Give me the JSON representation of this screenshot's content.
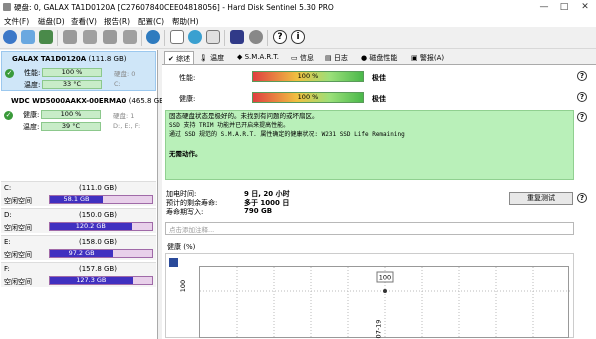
{
  "window": {
    "title": "硬盘: 0, GALAX TA1D0120A [C27607840CEE04818056]  -  Hard Disk Sentinel 5.30 PRO",
    "minimize": "—",
    "maximize": "□",
    "close": "✕"
  },
  "menu": [
    "文件(F)",
    "磁盘(D)",
    "查看(V)",
    "报告(R)",
    "配置(C)",
    "帮助(H)"
  ],
  "toolbar_icons": [
    "refresh-icon",
    "disk-info-icon",
    "image-icon",
    "drive-test-1-icon",
    "drive-test-2-icon",
    "drive-test-3-icon",
    "drive-test-4-icon",
    "globe-icon",
    "document-icon",
    "recycle-icon",
    "export-icon",
    "report-icon",
    "settings-icon",
    "help-icon",
    "info-icon"
  ],
  "disks": [
    {
      "name": "GALAX TA1D0120A",
      "size": "(111.8 GB)",
      "perf_label": "性能:",
      "perf": "100 %",
      "perf_sub": "硬盘: 0",
      "temp_label": "温度:",
      "temp": "33 °C",
      "temp_sub": "C:"
    },
    {
      "name": "WDC WD5000AAKX-00ERMA0",
      "size": "(465.8 GB)",
      "perf_label": "健康:",
      "perf": "100 %",
      "perf_sub": "硬盘: 1",
      "temp_label": "温度:",
      "temp": "39 °C",
      "temp_sub": "D:, E:, F:"
    }
  ],
  "partitions": [
    {
      "letter": "C:",
      "size": "(111.0 GB)",
      "free_label": "空闲空间",
      "free": "58.1 GB",
      "free_fraction": 0.52
    },
    {
      "letter": "D:",
      "size": "(150.0 GB)",
      "free_label": "空闲空间",
      "free": "120.2 GB",
      "free_fraction": 0.8
    },
    {
      "letter": "E:",
      "size": "(158.0 GB)",
      "free_label": "空闲空间",
      "free": "97.2 GB",
      "free_fraction": 0.62
    },
    {
      "letter": "F:",
      "size": "(157.8 GB)",
      "free_label": "空闲空间",
      "free": "127.3 GB",
      "free_fraction": 0.81
    }
  ],
  "tabs": [
    "综述",
    "温度",
    "S.M.A.R.T.",
    "信息",
    "日志",
    "磁盘性能",
    "警报(A)"
  ],
  "overview": {
    "perf_label": "性能:",
    "perf_value": "100 %",
    "perf_status": "极佳",
    "health_label": "健康:",
    "health_value": "100 %",
    "health_status": "极佳",
    "message_line1": "固态硬盘状态是极好的。未找到有问题的或坏扇区。",
    "message_line2": "SSD 支持 TRIM 功能并已开启来提高性能。",
    "message_line3": "通过 SSD 规范的 S.M.A.R.T. 属性确定的健康状况:    W231 SSD Life Remaining",
    "message_action": "无需动作。",
    "power_on_label": "加电时间:",
    "power_on_value": "9 日, 20 小时",
    "remaining_label": "预计的剩余寿命:",
    "remaining_value": "多于 1000 日",
    "lifetime_label": "寿命期写入:",
    "lifetime_value": "790 GB",
    "retest_button": "重复测试",
    "comment_placeholder": "点击添加注释...",
    "chart_tab": "健康 (%)"
  },
  "chart_data": {
    "type": "line",
    "x": [
      "07-19"
    ],
    "y_axis_label": "100",
    "series": [
      {
        "values": [
          100
        ]
      }
    ],
    "point_label": "100"
  }
}
